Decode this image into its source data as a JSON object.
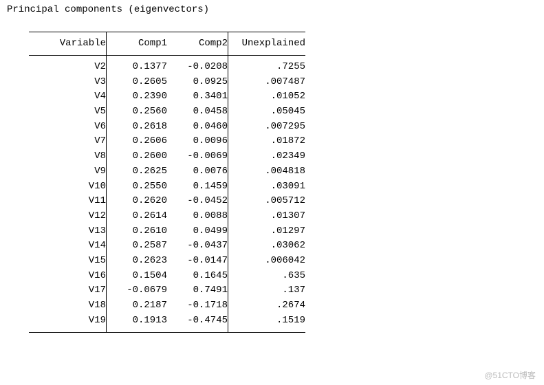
{
  "title": "Principal components (eigenvectors)",
  "headers": {
    "variable": "Variable",
    "comp1": "Comp1",
    "comp2": "Comp2",
    "unexplained": "Unexplained"
  },
  "rows": [
    {
      "variable": "V2",
      "comp1": "0.1377",
      "comp2": "-0.0208",
      "unexplained": ".7255"
    },
    {
      "variable": "V3",
      "comp1": "0.2605",
      "comp2": "0.0925",
      "unexplained": ".007487"
    },
    {
      "variable": "V4",
      "comp1": "0.2390",
      "comp2": "0.3401",
      "unexplained": ".01052"
    },
    {
      "variable": "V5",
      "comp1": "0.2560",
      "comp2": "0.0458",
      "unexplained": ".05045"
    },
    {
      "variable": "V6",
      "comp1": "0.2618",
      "comp2": "0.0460",
      "unexplained": ".007295"
    },
    {
      "variable": "V7",
      "comp1": "0.2606",
      "comp2": "0.0096",
      "unexplained": ".01872"
    },
    {
      "variable": "V8",
      "comp1": "0.2600",
      "comp2": "-0.0069",
      "unexplained": ".02349"
    },
    {
      "variable": "V9",
      "comp1": "0.2625",
      "comp2": "0.0076",
      "unexplained": ".004818"
    },
    {
      "variable": "V10",
      "comp1": "0.2550",
      "comp2": "0.1459",
      "unexplained": ".03091"
    },
    {
      "variable": "V11",
      "comp1": "0.2620",
      "comp2": "-0.0452",
      "unexplained": ".005712"
    },
    {
      "variable": "V12",
      "comp1": "0.2614",
      "comp2": "0.0088",
      "unexplained": ".01307"
    },
    {
      "variable": "V13",
      "comp1": "0.2610",
      "comp2": "0.0499",
      "unexplained": ".01297"
    },
    {
      "variable": "V14",
      "comp1": "0.2587",
      "comp2": "-0.0437",
      "unexplained": ".03062"
    },
    {
      "variable": "V15",
      "comp1": "0.2623",
      "comp2": "-0.0147",
      "unexplained": ".006042"
    },
    {
      "variable": "V16",
      "comp1": "0.1504",
      "comp2": "0.1645",
      "unexplained": ".635"
    },
    {
      "variable": "V17",
      "comp1": "-0.0679",
      "comp2": "0.7491",
      "unexplained": ".137"
    },
    {
      "variable": "V18",
      "comp1": "0.2187",
      "comp2": "-0.1718",
      "unexplained": ".2674"
    },
    {
      "variable": "V19",
      "comp1": "0.1913",
      "comp2": "-0.4745",
      "unexplained": ".1519"
    }
  ],
  "watermark": "@51CTO博客"
}
